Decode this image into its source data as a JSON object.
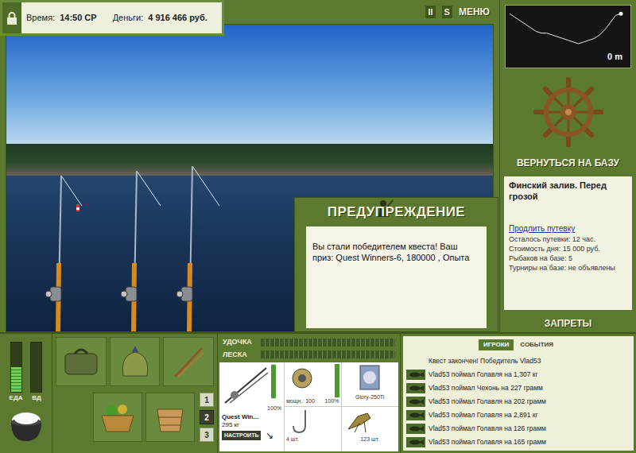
{
  "status_bar": {
    "time_label": "Время:",
    "time": "14:50 СР",
    "money_label": "Деньги:",
    "money": "4 916 466 руб."
  },
  "top_controls": [
    "II",
    "S",
    "МЕНЮ"
  ],
  "depth_chart": {
    "reading": "0 m",
    "profile": [
      1,
      3,
      5,
      7,
      9,
      11,
      12,
      12,
      13,
      14,
      15,
      16,
      17,
      18,
      17,
      16,
      15,
      13,
      10,
      6,
      2,
      1
    ]
  },
  "return_button": "ВЕРНУТЬСЯ НА БАЗУ",
  "location": {
    "title": "Финский залив. Перед грозой",
    "extend_link": "Продлить путевку",
    "details": [
      "Осталось путевки: 12 час.",
      "Стоимость дня: 15 000 руб.",
      "Рыбаков на базе: 5",
      "Турниры на базе: не объявлены"
    ]
  },
  "bans_button": "ЗАПРЕТЫ",
  "dialog": {
    "title": "ПРЕДУПРЕЖДЕНИЕ",
    "message": "Вы стали победителем квеста! Ваш приз: Quest Winners-6, 180000 , Опыта"
  },
  "meters": [
    {
      "label": "ЕДА",
      "level": 0.5
    },
    {
      "label": "ВД",
      "level": 0
    }
  ],
  "slots": [
    {
      "label": "1",
      "selected": false
    },
    {
      "label": "2",
      "selected": true
    },
    {
      "label": "3",
      "selected": false
    }
  ],
  "tackle": {
    "bars": [
      {
        "label": "УДОЧКА",
        "level": 0
      },
      {
        "label": "ЛЕСКА",
        "level": 0
      }
    ],
    "rod": {
      "name": "Quest Win...",
      "load": "295 кг",
      "condition": "100%",
      "level": 1
    },
    "configure": "НАСТРОИТЬ",
    "reel": {
      "power": "мощн.: 100",
      "condition": "100%",
      "level": 1
    },
    "line": {
      "name": "Glory-250Ti"
    },
    "hook": {
      "count": "4 шт."
    },
    "bait": {
      "count": "123 шт."
    }
  },
  "events": {
    "tabs": [
      {
        "label": "ИГРОКИ",
        "selected": true
      },
      {
        "label": "СОБЫТИЯ",
        "selected": false
      }
    ],
    "messages": [
      {
        "kind": "notice",
        "text": "Квест закончен! Победитель Vlad53"
      },
      {
        "kind": "catch",
        "text": "Vlad53 поймал Голавля на 1,307 кг"
      },
      {
        "kind": "catch",
        "text": "Vlad53 поймал Чехонь на 227 грамм"
      },
      {
        "kind": "catch",
        "text": "Vlad53 поймал Голавля на 202 грамм"
      },
      {
        "kind": "catch",
        "text": "Vlad53 поймал Голавля на 2,891 кг"
      },
      {
        "kind": "catch",
        "text": "Vlad53 поймал Голавля на 126 грамм"
      },
      {
        "kind": "catch",
        "text": "Vlad53 поймал Голавля на 165 грамм"
      }
    ]
  }
}
